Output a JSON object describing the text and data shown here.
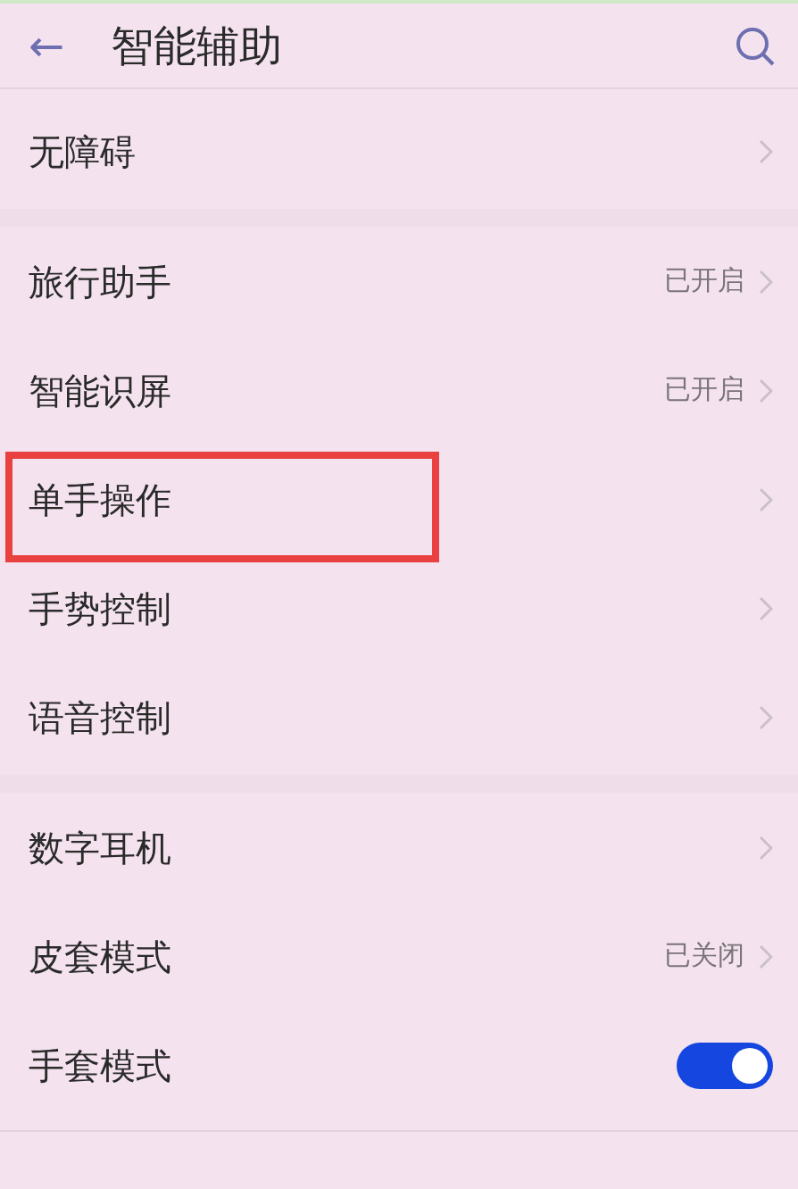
{
  "header": {
    "back": "←",
    "title": "智能辅助"
  },
  "groups": [
    {
      "items": [
        {
          "kind": "link",
          "label": "无障碍",
          "highlighted": false
        }
      ]
    },
    {
      "items": [
        {
          "kind": "link",
          "label": "旅行助手",
          "value": "已开启",
          "highlighted": false
        },
        {
          "kind": "link",
          "label": "智能识屏",
          "value": "已开启",
          "highlighted": false
        },
        {
          "kind": "link",
          "label": "单手操作",
          "highlighted": true
        },
        {
          "kind": "link",
          "label": "手势控制",
          "highlighted": false
        },
        {
          "kind": "link",
          "label": "语音控制",
          "highlighted": false
        }
      ]
    },
    {
      "items": [
        {
          "kind": "link",
          "label": "数字耳机",
          "highlighted": false
        },
        {
          "kind": "link",
          "label": "皮套模式",
          "value": "已关闭",
          "highlighted": false
        },
        {
          "kind": "toggle",
          "label": "手套模式",
          "on": true,
          "highlighted": false
        }
      ]
    }
  ]
}
